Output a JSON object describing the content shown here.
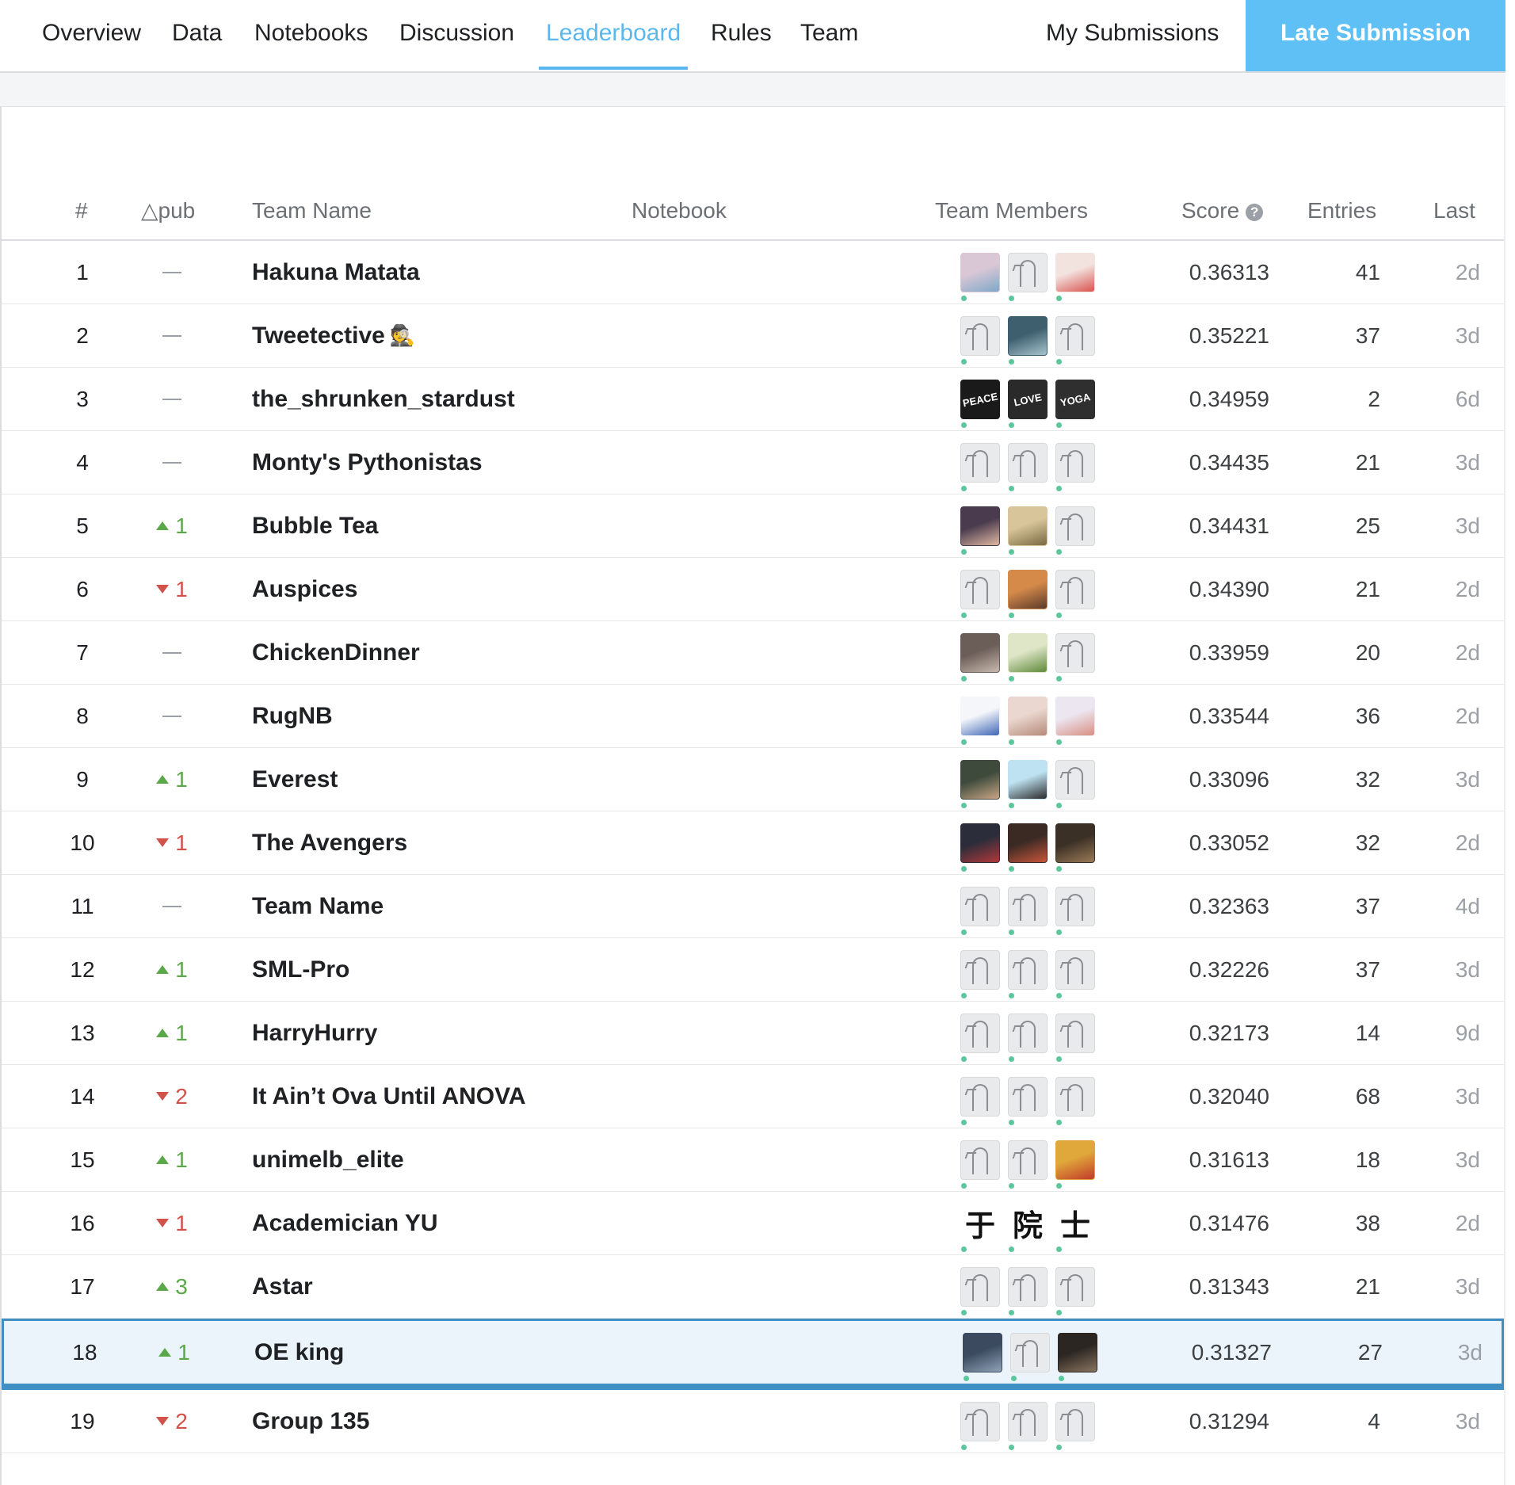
{
  "nav": {
    "tabs": [
      "Overview",
      "Data",
      "Notebooks",
      "Discussion",
      "Leaderboard",
      "Rules",
      "Team"
    ],
    "active": "Leaderboard",
    "my_submissions": "My Submissions",
    "late_submission": "Late Submission",
    "accent_color": "#5bb8ee",
    "button_color": "#5fc0f5"
  },
  "table": {
    "headers": {
      "rank": "#",
      "delta": "△pub",
      "team": "Team Name",
      "notebook": "Notebook",
      "members": "Team Members",
      "score": "Score",
      "entries": "Entries",
      "last": "Last"
    },
    "rows": [
      {
        "rank": "1",
        "delta": "—",
        "dir": "none",
        "team": "Hakuna Matata",
        "avatars": [
          {
            "kind": "photo",
            "color": "#d9c7d6",
            "shade": "#7fa8c9"
          },
          {
            "kind": "goose"
          },
          {
            "kind": "photo",
            "color": "#f3e3df",
            "shade": "#d9534f"
          }
        ],
        "score": "0.36313",
        "entries": "41",
        "last": "2d"
      },
      {
        "rank": "2",
        "delta": "—",
        "dir": "none",
        "team": "Tweetective",
        "badge": "🕵",
        "avatars": [
          {
            "kind": "goose"
          },
          {
            "kind": "photo",
            "color": "#3e5f6e",
            "shade": "#a7c4cf"
          },
          {
            "kind": "goose"
          }
        ],
        "score": "0.35221",
        "entries": "37",
        "last": "3d"
      },
      {
        "rank": "3",
        "delta": "—",
        "dir": "none",
        "team": "the_shrunken_stardust",
        "avatars": [
          {
            "kind": "sticker",
            "color": "#1a1a1a",
            "text": "PEACE"
          },
          {
            "kind": "sticker",
            "color": "#2a2a2a",
            "text": "LOVE"
          },
          {
            "kind": "sticker",
            "color": "#2f2f2f",
            "text": "YOGA"
          }
        ],
        "score": "0.34959",
        "entries": "2",
        "last": "6d"
      },
      {
        "rank": "4",
        "delta": "—",
        "dir": "none",
        "team": "Monty's Pythonistas",
        "avatars": [
          {
            "kind": "goose"
          },
          {
            "kind": "goose"
          },
          {
            "kind": "goose"
          }
        ],
        "score": "0.34435",
        "entries": "21",
        "last": "3d"
      },
      {
        "rank": "5",
        "delta": "1",
        "dir": "up",
        "team": "Bubble Tea",
        "avatars": [
          {
            "kind": "photo",
            "color": "#4a3b4e",
            "shade": "#e1b8a3"
          },
          {
            "kind": "photo",
            "color": "#d8c59a",
            "shade": "#7a6a42"
          },
          {
            "kind": "goose"
          }
        ],
        "score": "0.34431",
        "entries": "25",
        "last": "3d"
      },
      {
        "rank": "6",
        "delta": "1",
        "dir": "down",
        "team": "Auspices",
        "avatars": [
          {
            "kind": "goose"
          },
          {
            "kind": "photo",
            "color": "#d68a4a",
            "shade": "#5b3a2a"
          },
          {
            "kind": "goose"
          }
        ],
        "score": "0.34390",
        "entries": "21",
        "last": "2d"
      },
      {
        "rank": "7",
        "delta": "—",
        "dir": "none",
        "team": "ChickenDinner",
        "avatars": [
          {
            "kind": "photo",
            "color": "#6b5e58",
            "shade": "#c9b9ae"
          },
          {
            "kind": "photo",
            "color": "#dfe6c8",
            "shade": "#5e8a3a"
          },
          {
            "kind": "goose"
          }
        ],
        "score": "0.33959",
        "entries": "20",
        "last": "2d"
      },
      {
        "rank": "8",
        "delta": "—",
        "dir": "none",
        "team": "RugNB",
        "avatars": [
          {
            "kind": "photo",
            "color": "#f4f6fa",
            "shade": "#3f67b5"
          },
          {
            "kind": "photo",
            "color": "#ead7cf",
            "shade": "#b58a7a"
          },
          {
            "kind": "photo",
            "color": "#ece6f0",
            "shade": "#d98f83"
          }
        ],
        "score": "0.33544",
        "entries": "36",
        "last": "2d"
      },
      {
        "rank": "9",
        "delta": "1",
        "dir": "up",
        "team": "Everest",
        "avatars": [
          {
            "kind": "photo",
            "color": "#3d4a3c",
            "shade": "#c9a585"
          },
          {
            "kind": "photo",
            "color": "#bfe2f2",
            "shade": "#2a2a2a"
          },
          {
            "kind": "goose"
          }
        ],
        "score": "0.33096",
        "entries": "32",
        "last": "3d"
      },
      {
        "rank": "10",
        "delta": "1",
        "dir": "down",
        "team": "The Avengers",
        "avatars": [
          {
            "kind": "photo",
            "color": "#2b2d3a",
            "shade": "#b0383a"
          },
          {
            "kind": "photo",
            "color": "#3b2a24",
            "shade": "#c9553a"
          },
          {
            "kind": "photo",
            "color": "#3b3026",
            "shade": "#9a7a55"
          }
        ],
        "score": "0.33052",
        "entries": "32",
        "last": "2d"
      },
      {
        "rank": "11",
        "delta": "—",
        "dir": "none",
        "team": "Team Name",
        "avatars": [
          {
            "kind": "goose"
          },
          {
            "kind": "goose"
          },
          {
            "kind": "goose"
          }
        ],
        "score": "0.32363",
        "entries": "37",
        "last": "4d"
      },
      {
        "rank": "12",
        "delta": "1",
        "dir": "up",
        "team": "SML-Pro",
        "avatars": [
          {
            "kind": "goose"
          },
          {
            "kind": "goose"
          },
          {
            "kind": "goose"
          }
        ],
        "score": "0.32226",
        "entries": "37",
        "last": "3d"
      },
      {
        "rank": "13",
        "delta": "1",
        "dir": "up",
        "team": "HarryHurry",
        "avatars": [
          {
            "kind": "goose"
          },
          {
            "kind": "goose"
          },
          {
            "kind": "goose"
          }
        ],
        "score": "0.32173",
        "entries": "14",
        "last": "9d"
      },
      {
        "rank": "14",
        "delta": "2",
        "dir": "down",
        "team": "It Ain’t Ova Until ANOVA",
        "avatars": [
          {
            "kind": "goose"
          },
          {
            "kind": "goose"
          },
          {
            "kind": "goose"
          }
        ],
        "score": "0.32040",
        "entries": "68",
        "last": "3d"
      },
      {
        "rank": "15",
        "delta": "1",
        "dir": "up",
        "team": "unimelb_elite",
        "avatars": [
          {
            "kind": "goose"
          },
          {
            "kind": "goose"
          },
          {
            "kind": "photo",
            "color": "#e0a83a",
            "shade": "#c23a2a"
          }
        ],
        "score": "0.31613",
        "entries": "18",
        "last": "3d"
      },
      {
        "rank": "16",
        "delta": "1",
        "dir": "down",
        "team": "Academician YU",
        "avatars": [
          {
            "kind": "kanji",
            "text": "于"
          },
          {
            "kind": "kanji",
            "text": "院"
          },
          {
            "kind": "kanji",
            "text": "士"
          }
        ],
        "score": "0.31476",
        "entries": "38",
        "last": "2d"
      },
      {
        "rank": "17",
        "delta": "3",
        "dir": "up",
        "team": "Astar",
        "avatars": [
          {
            "kind": "goose"
          },
          {
            "kind": "goose"
          },
          {
            "kind": "goose"
          }
        ],
        "score": "0.31343",
        "entries": "21",
        "last": "3d"
      },
      {
        "rank": "18",
        "delta": "1",
        "dir": "up",
        "team": "OE king",
        "highlight": true,
        "avatars": [
          {
            "kind": "photo",
            "color": "#3b4a5e",
            "shade": "#8fa2b8"
          },
          {
            "kind": "goose"
          },
          {
            "kind": "photo",
            "color": "#2c2622",
            "shade": "#8a7560"
          }
        ],
        "score": "0.31327",
        "entries": "27",
        "last": "3d"
      },
      {
        "rank": "19",
        "delta": "2",
        "dir": "down",
        "team": "Group 135",
        "avatars": [
          {
            "kind": "goose"
          },
          {
            "kind": "goose"
          },
          {
            "kind": "goose"
          }
        ],
        "score": "0.31294",
        "entries": "4",
        "last": "3d"
      }
    ]
  }
}
